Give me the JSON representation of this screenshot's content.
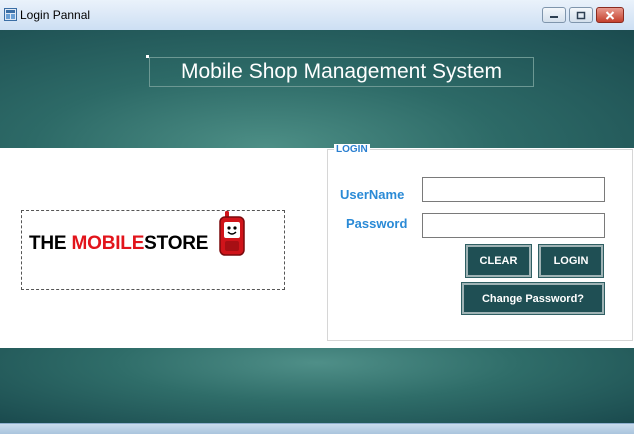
{
  "window": {
    "title": "Login Pannal",
    "controls": [
      "minimize",
      "maximize",
      "close"
    ]
  },
  "header": {
    "app_title": "Mobile Shop Management System"
  },
  "logo": {
    "text_prefix": "THE ",
    "text_highlight": "MOBILE",
    "text_suffix": "STORE",
    "icon": "mobile-phone-mascot-icon"
  },
  "login": {
    "group_title": "LOGIN",
    "username_label": "UserName",
    "password_label": "Password",
    "username_value": "",
    "password_value": "",
    "clear_label": "CLEAR",
    "login_label": "LOGIN",
    "change_password_label": "Change Password?"
  },
  "colors": {
    "header_bg": "#2d6a67",
    "label_blue": "#2a8ad6",
    "button_bg": "#1f4f54",
    "logo_red": "#e2141b"
  }
}
